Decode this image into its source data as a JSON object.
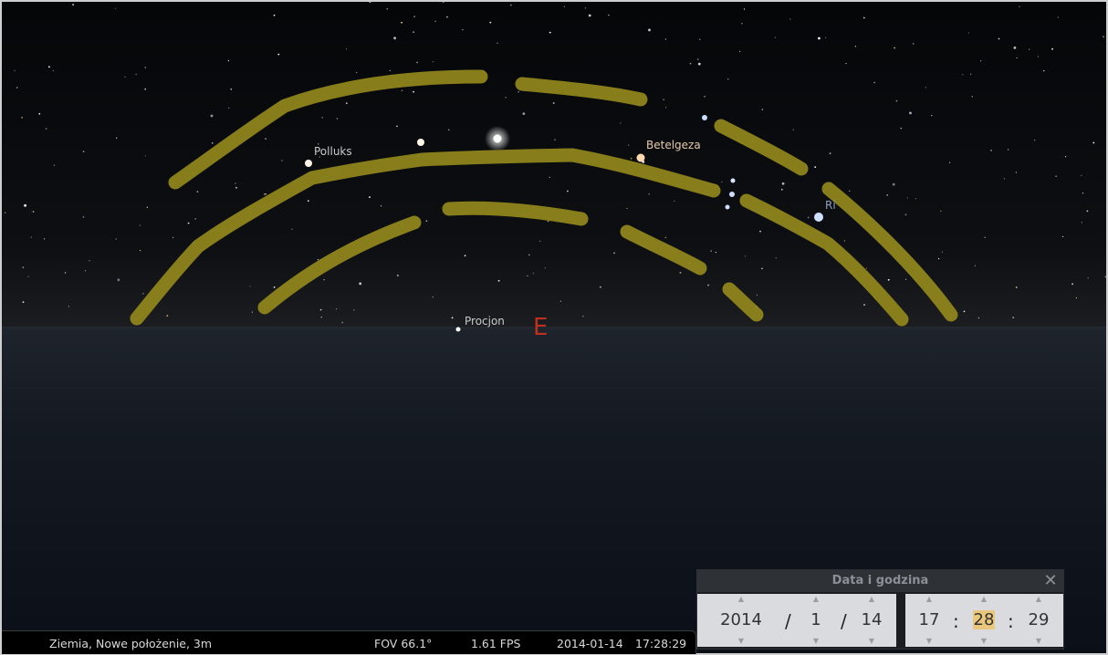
{
  "sky": {
    "labels": {
      "polluks": "Polluks",
      "betelgeza": "Betelgeza",
      "procjon": "Procjon",
      "rigel_partial": "Ri"
    },
    "cardinal": "E",
    "marking_color": "#8f841c",
    "horizon_color": "#1b2028"
  },
  "status_bar": {
    "location": "Ziemia, Nowe położenie, 3m",
    "fov": "FOV 66.1°",
    "fps": "1.61 FPS",
    "date": "2014-01-14",
    "time": "17:28:29"
  },
  "datetime_panel": {
    "title": "Data i godzina",
    "close_icon": "close-icon",
    "year": "2014",
    "month": "1",
    "day": "14",
    "hour": "17",
    "minute": "28",
    "second": "29",
    "date_separator": "/",
    "time_separator": ":"
  }
}
